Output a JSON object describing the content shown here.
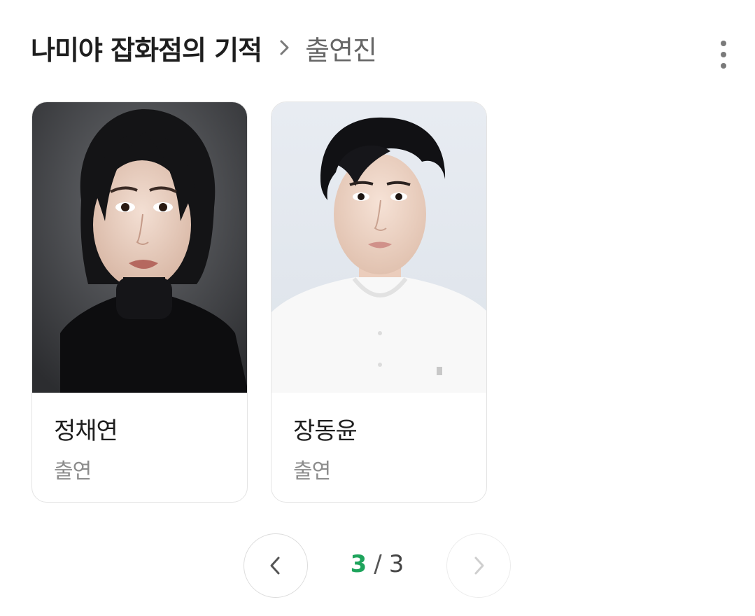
{
  "header": {
    "title": "나미야 잡화점의 기적",
    "subtitle": "출연진"
  },
  "cast": [
    {
      "name": "정채연",
      "role": "출연"
    },
    {
      "name": "장동윤",
      "role": "출연"
    }
  ],
  "pagination": {
    "current": "3",
    "separator": "/",
    "total": "3"
  },
  "colors": {
    "accent": "#1ea45c",
    "title": "#1e1e1e",
    "muted": "#8c8c8c"
  },
  "icons": {
    "breadcrumb": "chevron-right-icon",
    "menu": "more-vertical-icon",
    "prev": "chevron-left-icon",
    "next": "chevron-right-icon"
  }
}
